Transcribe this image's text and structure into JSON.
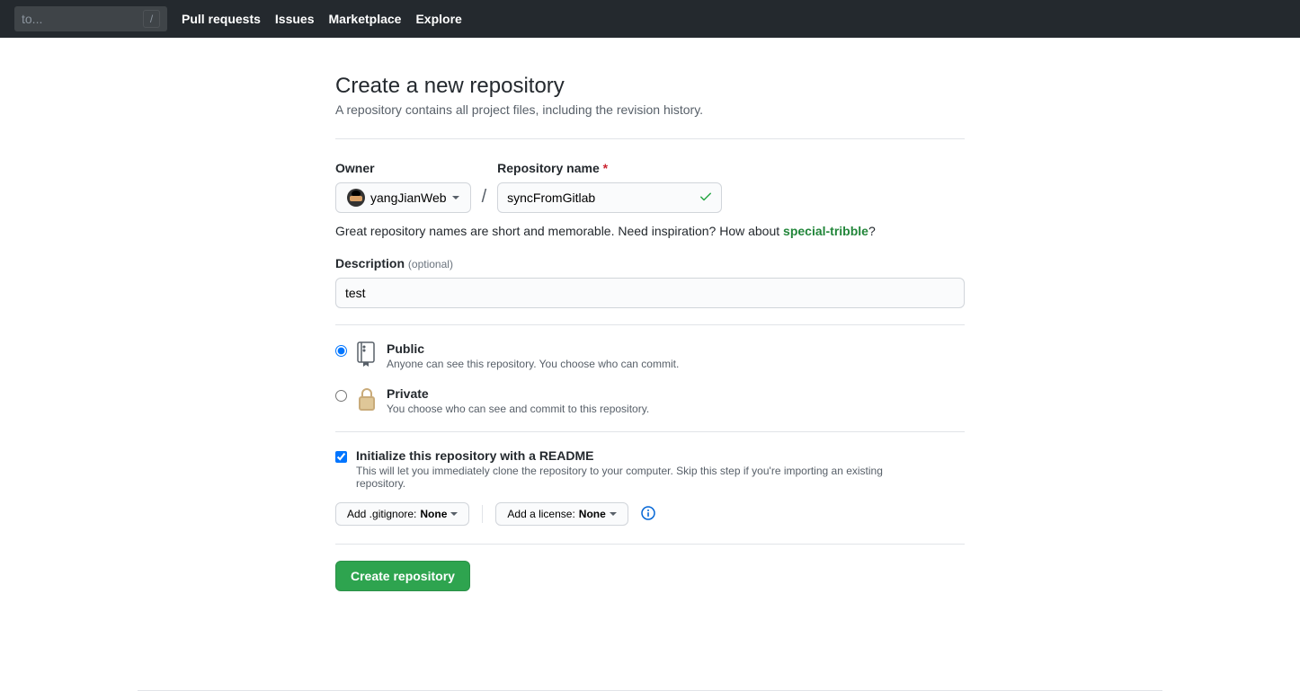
{
  "header": {
    "search_placeholder": "to...",
    "search_key": "/",
    "nav": [
      "Pull requests",
      "Issues",
      "Marketplace",
      "Explore"
    ]
  },
  "page": {
    "title": "Create a new repository",
    "subtitle": "A repository contains all project files, including the revision history."
  },
  "form": {
    "owner_label": "Owner",
    "owner_value": "yangJianWeb",
    "repo_label": "Repository name",
    "repo_value": "syncFromGitlab",
    "slash": "/",
    "required": "*",
    "hint_prefix": "Great repository names are short and memorable. Need inspiration? How about ",
    "hint_suggestion": "special-tribble",
    "hint_suffix": "?",
    "desc_label": "Description",
    "desc_optional": "(optional)",
    "desc_value": "test",
    "visibility": {
      "public": {
        "title": "Public",
        "desc": "Anyone can see this repository. You choose who can commit."
      },
      "private": {
        "title": "Private",
        "desc": "You choose who can see and commit to this repository."
      }
    },
    "readme": {
      "title": "Initialize this repository with a README",
      "desc": "This will let you immediately clone the repository to your computer. Skip this step if you're importing an existing repository."
    },
    "gitignore_prefix": "Add .gitignore: ",
    "gitignore_value": "None",
    "license_prefix": "Add a license: ",
    "license_value": "None",
    "submit": "Create repository"
  }
}
